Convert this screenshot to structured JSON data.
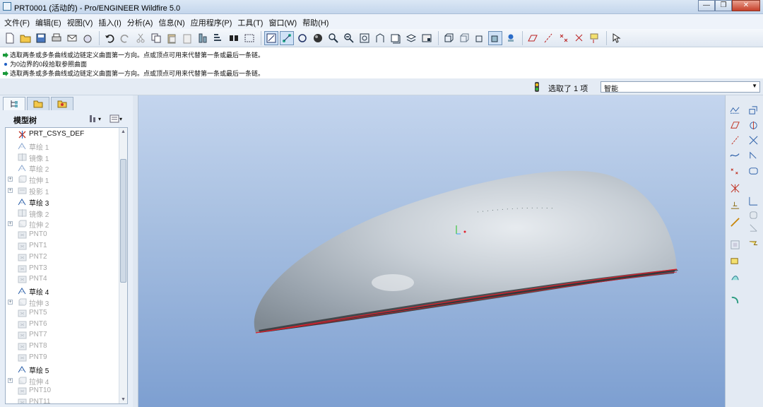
{
  "window": {
    "title": "PRT0001 (活动的) - Pro/ENGINEER Wildfire 5.0"
  },
  "menu": [
    "文件(F)",
    "编辑(E)",
    "视图(V)",
    "插入(I)",
    "分析(A)",
    "信息(N)",
    "应用程序(P)",
    "工具(T)",
    "窗口(W)",
    "帮助(H)"
  ],
  "toolbar_icons": [
    "new-icon",
    "open-icon",
    "save-icon",
    "print-icon",
    "send-icon",
    "send-to-icon",
    "undo-icon",
    "redo-icon",
    "cut-icon",
    "copy-icon",
    "paste-icon",
    "paste-special-icon",
    "regenerate-icon",
    "regen-manager-icon",
    "find-icon",
    "select-box-icon",
    "repaint-icon",
    "orient-icon",
    "saved-views-icon",
    "shading-icon",
    "zoom-in-icon",
    "zoom-out-icon",
    "refit-icon",
    "reorient-icon",
    "view-manager-icon",
    "layers-icon",
    "appearance-icon",
    "wireframe-icon",
    "hidden-line-icon",
    "no-hidden-icon",
    "shading-mode-icon",
    "datum-display-icon",
    "plane-display-icon",
    "axis-display-icon",
    "point-display-icon",
    "csys-display-icon",
    "whats-this-icon"
  ],
  "messages": [
    {
      "icon": "prompt-arrow-icon",
      "text": "选取两条或多条曲线或边链定义曲面第一方向。点或顶点可用来代替第一条或最后一条链。"
    },
    {
      "icon": "info-dot-icon",
      "text": "为0边界的0段拾取参照曲面"
    },
    {
      "icon": "prompt-arrow-icon",
      "text": "选取两条或多条曲线或边链定义曲面第一方向。点或顶点可用来代替第一条或最后一条链。"
    }
  ],
  "status": {
    "selected_text": "选取了 1 项",
    "filter_value": "智能"
  },
  "left_panel": {
    "tree_title": "模型树",
    "items": [
      {
        "label": "PRT_CSYS_DEF",
        "icon": "csys-icon",
        "dim": false,
        "expandable": false
      },
      {
        "label": "草绘 1",
        "icon": "sketch-icon",
        "dim": true,
        "expandable": false
      },
      {
        "label": "镜像 1",
        "icon": "mirror-icon",
        "dim": true,
        "expandable": false
      },
      {
        "label": "草绘 2",
        "icon": "sketch-icon",
        "dim": true,
        "expandable": false
      },
      {
        "label": "拉伸 1",
        "icon": "extrude-icon",
        "dim": true,
        "expandable": true
      },
      {
        "label": "投影 1",
        "icon": "projection-icon",
        "dim": true,
        "expandable": true
      },
      {
        "label": "草绘 3",
        "icon": "sketch-icon",
        "dim": false,
        "expandable": false
      },
      {
        "label": "镜像 2",
        "icon": "mirror-icon",
        "dim": true,
        "expandable": false
      },
      {
        "label": "拉伸 2",
        "icon": "extrude-icon",
        "dim": true,
        "expandable": true
      },
      {
        "label": "PNT0",
        "icon": "datum-point-icon",
        "dim": true,
        "expandable": false
      },
      {
        "label": "PNT1",
        "icon": "datum-point-icon",
        "dim": true,
        "expandable": false
      },
      {
        "label": "PNT2",
        "icon": "datum-point-icon",
        "dim": true,
        "expandable": false
      },
      {
        "label": "PNT3",
        "icon": "datum-point-icon",
        "dim": true,
        "expandable": false
      },
      {
        "label": "PNT4",
        "icon": "datum-point-icon",
        "dim": true,
        "expandable": false
      },
      {
        "label": "草绘 4",
        "icon": "sketch-icon",
        "dim": false,
        "expandable": false
      },
      {
        "label": "拉伸 3",
        "icon": "extrude-icon",
        "dim": true,
        "expandable": true
      },
      {
        "label": "PNT5",
        "icon": "datum-point-icon",
        "dim": true,
        "expandable": false
      },
      {
        "label": "PNT6",
        "icon": "datum-point-icon",
        "dim": true,
        "expandable": false
      },
      {
        "label": "PNT7",
        "icon": "datum-point-icon",
        "dim": true,
        "expandable": false
      },
      {
        "label": "PNT8",
        "icon": "datum-point-icon",
        "dim": true,
        "expandable": false
      },
      {
        "label": "PNT9",
        "icon": "datum-point-icon",
        "dim": true,
        "expandable": false
      },
      {
        "label": "草绘 5",
        "icon": "sketch-icon",
        "dim": false,
        "expandable": false
      },
      {
        "label": "拉伸 4",
        "icon": "extrude-icon",
        "dim": true,
        "expandable": true
      },
      {
        "label": "PNT10",
        "icon": "datum-point-icon",
        "dim": true,
        "expandable": false
      },
      {
        "label": "PNT11",
        "icon": "datum-point-icon",
        "dim": true,
        "expandable": false
      }
    ]
  },
  "right_toolbar_icons": [
    "datum-plane-icon",
    "datum-axis-icon",
    "datum-curve-icon",
    "sketch-tool-icon",
    "point-tool-icon",
    "csys-tool-icon",
    "analysis-feature-icon",
    "mirror-tool-icon",
    "extrude-tool-icon",
    "revolve-tool-icon",
    "sweep-tool-icon",
    "blend-tool-icon",
    "hole-tool-icon",
    "shell-tool-icon",
    "rib-tool-icon",
    "draft-tool-icon",
    "round-tool-icon",
    "chamfer-tool-icon",
    "pattern-tool-icon",
    "copy-geometry-icon",
    "style-tool-icon"
  ],
  "colors": {
    "model_surface": "#c9d0d6",
    "edge_highlight": "#e0202c",
    "graphics_bg_top": "#c4d5ee",
    "graphics_bg_bottom": "#7d9fd1"
  }
}
